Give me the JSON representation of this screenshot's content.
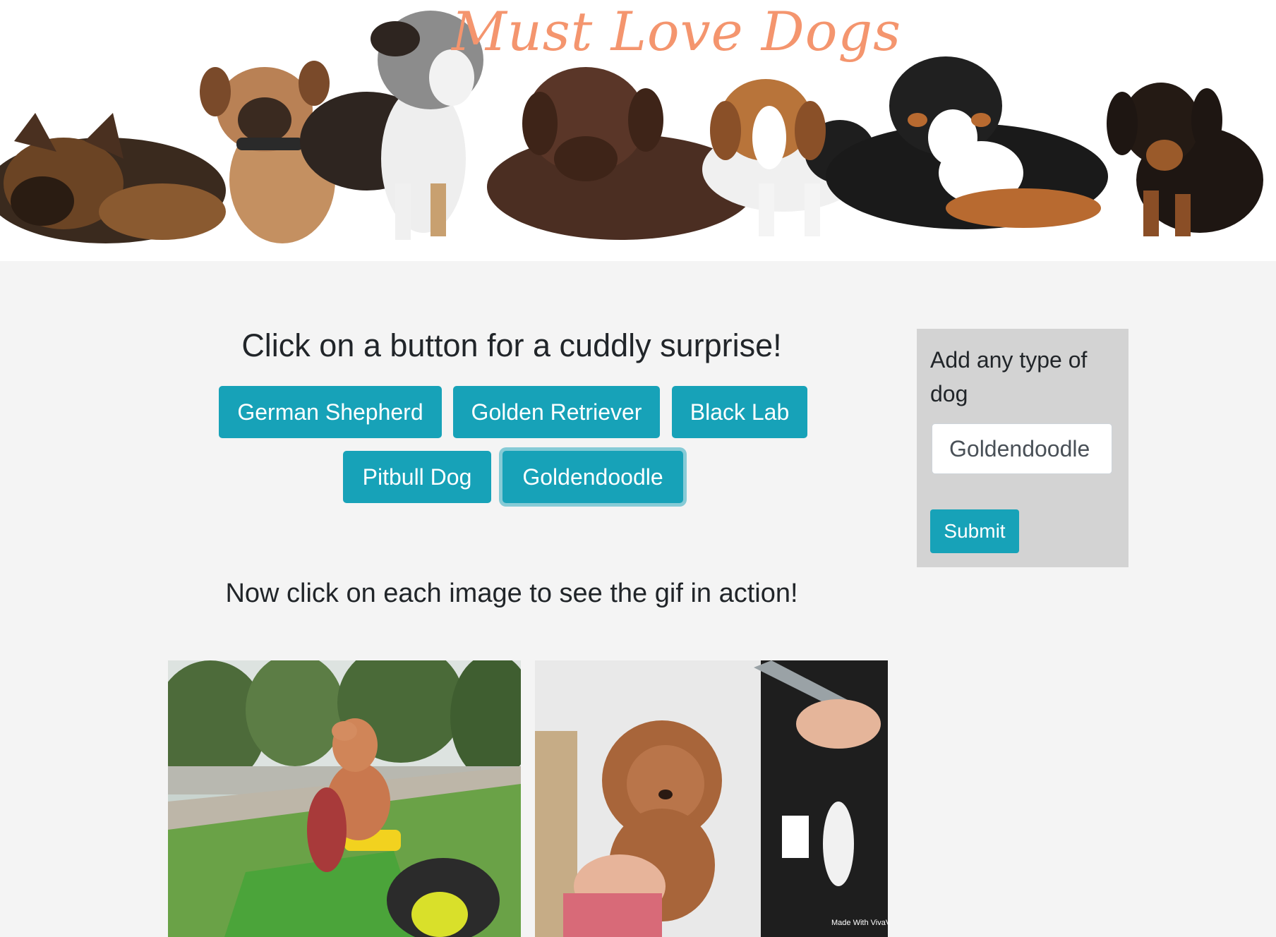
{
  "banner": {
    "title": "Must Love Dogs",
    "title_color": "#f4956e"
  },
  "main": {
    "heading": "Click on a button for a cuddly surprise!",
    "buttons": [
      {
        "label": "German Shepherd"
      },
      {
        "label": "Golden Retriever"
      },
      {
        "label": "Black Lab"
      },
      {
        "label": "Pitbull Dog"
      },
      {
        "label": "Goldendoodle",
        "focused": true
      }
    ],
    "subheading": "Now click on each image to see the gif in action!"
  },
  "sidebar": {
    "label": "Add any type of dog",
    "input_value": "Goldendoodle",
    "submit_label": "Submit"
  },
  "gifs": [
    {
      "subject": "poodle-on-lawn-mower"
    },
    {
      "subject": "poodle-puppy-grooming",
      "watermark": "Made With VivaVideo"
    }
  ],
  "colors": {
    "accent": "#17a2b8",
    "page_bg": "#f4f4f4",
    "sidebar_bg": "#d3d3d3"
  }
}
